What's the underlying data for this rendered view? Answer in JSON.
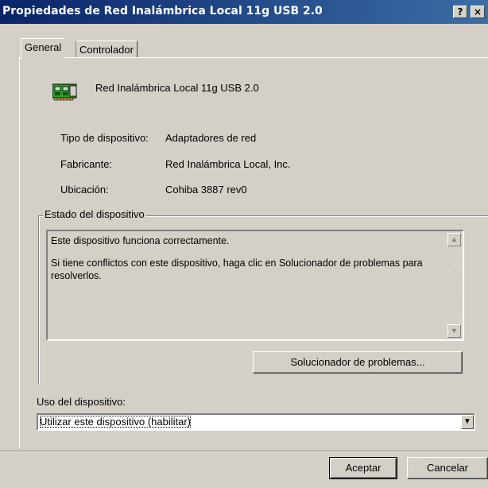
{
  "window": {
    "title": "Propiedades de Red Inalámbrica Local 11g USB 2.0",
    "help_btn": "?",
    "close_btn": "×"
  },
  "tabs": [
    {
      "label": "General",
      "active": true
    },
    {
      "label": "Controlador",
      "active": false
    }
  ],
  "device": {
    "icon": "network-card-icon",
    "name": "Red Inalámbrica Local 11g USB 2.0"
  },
  "properties": [
    {
      "label": "Tipo de dispositivo:",
      "value": "Adaptadores de red"
    },
    {
      "label": "Fabricante:",
      "value": "Red Inalámbrica Local, Inc."
    },
    {
      "label": "Ubicación:",
      "value": "Cohiba 3887 rev0"
    }
  ],
  "status_group": {
    "legend": "Estado del dispositivo",
    "lines": [
      "Este dispositivo funciona correctamente.",
      "Si tiene conflictos con este dispositivo, haga clic en Solucionador de problemas para resolverlos."
    ],
    "troubleshoot_button": "Solucionador de problemas..."
  },
  "usage": {
    "label": "Uso del dispositivo:",
    "selected": "Utilizar este dispositivo (habilitar)"
  },
  "footer": {
    "ok_button": "Aceptar",
    "cancel_button": "Cancelar"
  },
  "colors": {
    "title_gradient_start": "#0a246a",
    "title_gradient_end": "#3a6ea5",
    "face": "#d4d0c8",
    "icon_green": "#2f9b2f"
  }
}
